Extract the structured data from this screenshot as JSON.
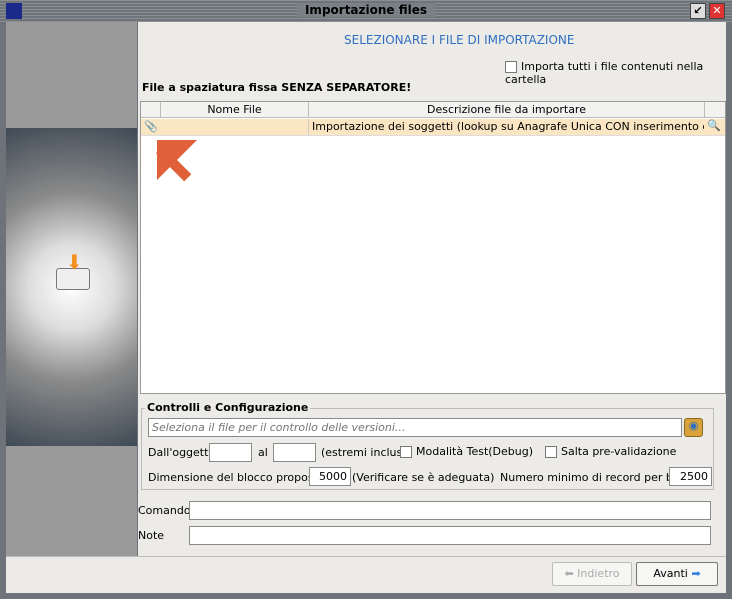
{
  "window": {
    "title": "Importazione files"
  },
  "header": {
    "title": "SELEZIONARE I FILE DI IMPORTAZIONE",
    "import_all_label": "Importa tutti i file contenuti nella cartella",
    "warning": "File a spaziatura fissa SENZA SEPARATORE!"
  },
  "table": {
    "columns": [
      "Nome File",
      "Descrizione file da importare"
    ],
    "rows": [
      {
        "file": "",
        "description": "Importazione dei soggetti (lookup su Anagrafe Unica CON inserimento e lookup su A"
      }
    ]
  },
  "config": {
    "title": "Controlli e Configurazione",
    "version_file_placeholder": "Seleziona il file per il controllo delle versioni...",
    "from_label": "Dall'oggetto",
    "to_label": "al",
    "inclusive_label": "(estremi inclusi)",
    "test_mode_label": "Modalità Test(Debug)",
    "skip_validation_label": "Salta pre-validazione",
    "block_size_label": "Dimensione del blocco proposta",
    "block_size": "5000",
    "block_hint": "(Verificare se è adeguata)",
    "min_records_label": "Numero minimo di record per blocco",
    "min_records": "2500"
  },
  "command": {
    "label": "Comando",
    "value": ""
  },
  "note": {
    "label": "Note",
    "value": ""
  },
  "buttons": {
    "back": "Indietro",
    "next": "Avanti"
  },
  "colors": {
    "accent": "#2f6fc0",
    "row_highlight": "#fbe6c4",
    "arrow": "#e0603a"
  }
}
